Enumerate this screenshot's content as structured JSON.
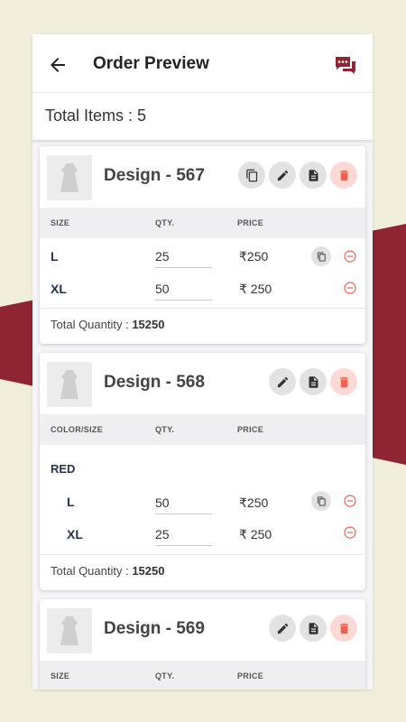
{
  "header": {
    "title": "Order Preview"
  },
  "summary": {
    "total_items": "Total Items : 5"
  },
  "currency": "₹",
  "cards": [
    {
      "name": "Design - 567",
      "headers": [
        "SIZE",
        "QTY.",
        "PRICE"
      ],
      "rows": [
        {
          "size": "L",
          "qty": "25",
          "price": "₹250"
        },
        {
          "size": "XL",
          "qty": "50",
          "price": "₹ 250"
        }
      ],
      "total_label": "Total Quantity : ",
      "total_value": "15250"
    },
    {
      "name": "Design - 568",
      "headers": [
        "COLOR/SIZE",
        "QTY.",
        "PRICE"
      ],
      "color": "RED",
      "rows": [
        {
          "size": "L",
          "qty": "50",
          "price": "₹250"
        },
        {
          "size": "XL",
          "qty": "25",
          "price": "₹ 250"
        }
      ],
      "total_label": "Total Quantity : ",
      "total_value": "15250"
    },
    {
      "name": "Design - 569",
      "headers": [
        "SIZE",
        "QTY.",
        "PRICE"
      ]
    }
  ],
  "icons": {
    "back": "arrow-left-icon",
    "chat": "chat-icon",
    "copy": "copy-icon",
    "edit": "pencil-icon",
    "note": "document-icon",
    "delete": "trash-icon",
    "remove": "minus-circle-icon",
    "thumb": "dress-icon"
  },
  "colors": {
    "accent": "#8f2433",
    "background": "#f2eedc",
    "delete_bg": "#fdd9d5",
    "delete_fg": "#f0604d",
    "size_text": "#24344f"
  }
}
